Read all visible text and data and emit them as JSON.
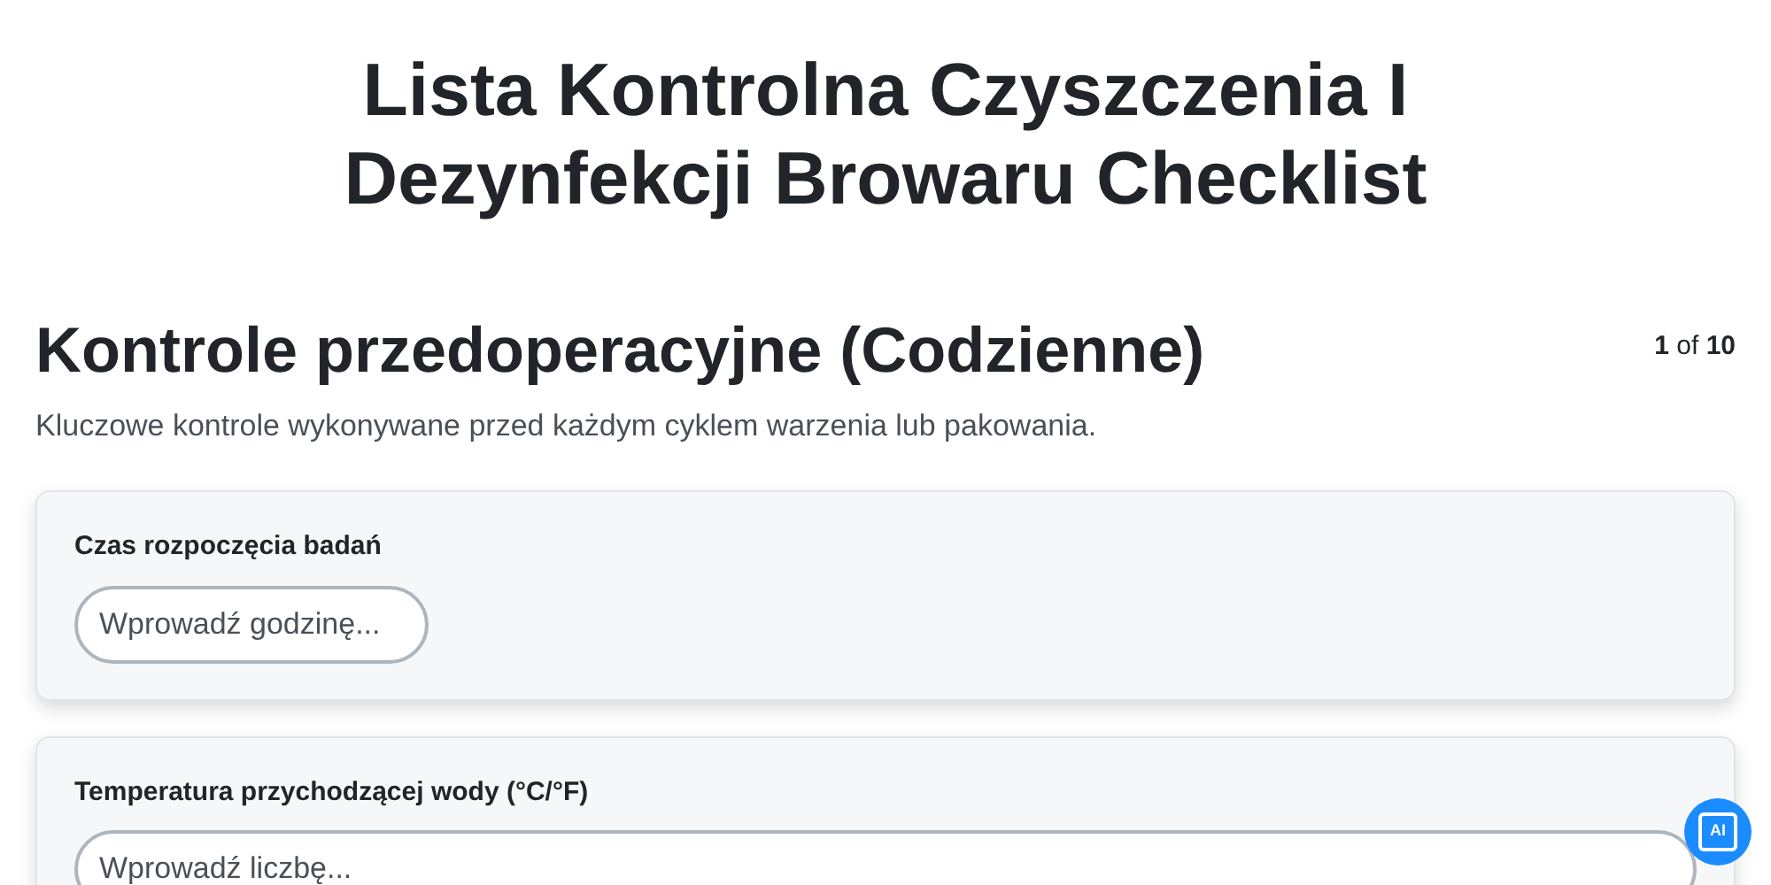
{
  "title": "Lista Kontrolna Czyszczenia I Dezynfekcji Browaru Checklist",
  "section": {
    "heading": "Kontrole przedoperacyjne (Codzienne)",
    "description": "Kluczowe kontrole wykonywane przed każdym cyklem warzenia lub pakowania.",
    "page": "1",
    "page_sep": "of",
    "page_total": "10"
  },
  "questions": [
    {
      "kind": "time",
      "label": "Czas rozpoczęcia badań",
      "placeholder": "Wprowadź godzinę..."
    },
    {
      "kind": "number",
      "label": "Temperatura przychodzącej wody (°C/°F)",
      "placeholder": "Wprowadź liczbę..."
    }
  ],
  "ai_button": {
    "label": "AI"
  }
}
